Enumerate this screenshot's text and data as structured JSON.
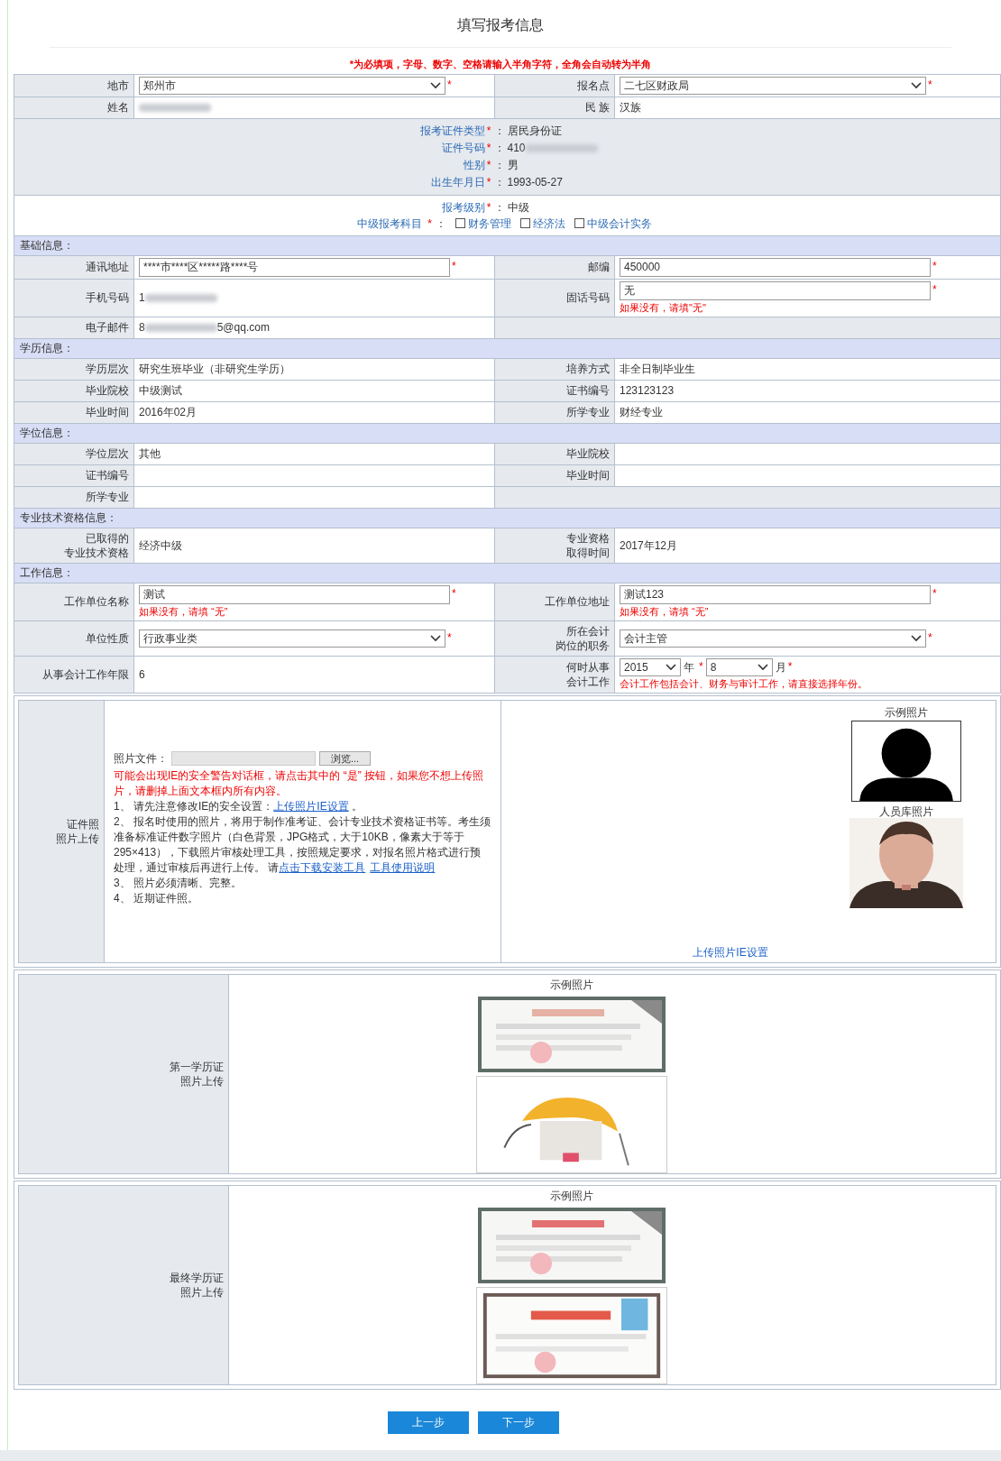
{
  "title": "填写报考信息",
  "notice": "*为必填项，字母、数字、空格请输入半角字符，全角会自动转为半角",
  "required_mark": "*",
  "colon": "：",
  "top_rows": [
    {
      "left": {
        "label": "地市",
        "field": {
          "kind": "select",
          "value": "郑州市",
          "required": true
        }
      },
      "right": {
        "label": "报名点",
        "field": {
          "kind": "select",
          "value": "二七区财政局",
          "required": true
        }
      }
    },
    {
      "left": {
        "label": "姓名",
        "field": {
          "kind": "parts",
          "parts": [
            {
              "kind": "blur"
            }
          ]
        }
      },
      "right": {
        "label": "民 族",
        "field": {
          "kind": "text",
          "value": "汉族"
        }
      }
    }
  ],
  "identity": [
    {
      "label": "报考证件类型",
      "required": true,
      "parts": [
        {
          "kind": "text",
          "text": "居民身份证"
        }
      ]
    },
    {
      "label": "证件号码",
      "required": true,
      "parts": [
        {
          "kind": "text",
          "text": "410"
        },
        {
          "kind": "blur"
        }
      ]
    },
    {
      "label": "性别",
      "required": true,
      "parts": [
        {
          "kind": "text",
          "text": "男"
        }
      ]
    },
    {
      "label": "出生年月日",
      "required": true,
      "parts": [
        {
          "kind": "text",
          "text": "1993-05-27"
        }
      ]
    }
  ],
  "exam_level": {
    "label": "报考级别",
    "required": true,
    "value": "中级"
  },
  "subjects": {
    "label": "中级报考科目",
    "required": true,
    "options": [
      {
        "label": "财务管理",
        "checked": false
      },
      {
        "label": "经济法",
        "checked": false
      },
      {
        "label": "中级会计实务",
        "checked": false
      }
    ]
  },
  "sections": [
    {
      "heading": "基础信息：",
      "rows": [
        {
          "left": {
            "label": "通讯地址",
            "field": {
              "kind": "input",
              "value": "****市****区*****路****号",
              "required": true
            }
          },
          "right": {
            "label": "邮编",
            "field": {
              "kind": "input",
              "value": "450000",
              "required": true
            }
          }
        },
        {
          "left": {
            "label": "手机号码",
            "field": {
              "kind": "parts",
              "parts": [
                {
                  "kind": "text",
                  "text": "1"
                },
                {
                  "kind": "blur"
                }
              ]
            }
          },
          "right": {
            "label": "固话号码",
            "field": {
              "kind": "input",
              "value": "无",
              "required": true,
              "hint": "如果没有，请填\"无\""
            }
          }
        },
        {
          "left": {
            "label": "电子邮件",
            "field": {
              "kind": "parts",
              "parts": [
                {
                  "kind": "text",
                  "text": "8"
                },
                {
                  "kind": "blur"
                },
                {
                  "kind": "text",
                  "text": "5@qq.com"
                }
              ]
            }
          }
        }
      ]
    },
    {
      "heading": "学历信息：",
      "rows": [
        {
          "left": {
            "label": "学历层次",
            "field": {
              "kind": "text",
              "value": "研究生班毕业（非研究生学历）"
            }
          },
          "right": {
            "label": "培养方式",
            "field": {
              "kind": "text",
              "value": "非全日制毕业生"
            }
          }
        },
        {
          "left": {
            "label": "毕业院校",
            "field": {
              "kind": "text",
              "value": "中级测试"
            }
          },
          "right": {
            "label": "证书编号",
            "field": {
              "kind": "text",
              "value": "123123123"
            }
          }
        },
        {
          "left": {
            "label": "毕业时间",
            "field": {
              "kind": "text",
              "value": "2016年02月"
            }
          },
          "right": {
            "label": "所学专业",
            "field": {
              "kind": "text",
              "value": "财经专业"
            }
          }
        }
      ]
    },
    {
      "heading": "学位信息：",
      "rows": [
        {
          "left": {
            "label": "学位层次",
            "field": {
              "kind": "text",
              "value": "其他"
            }
          },
          "right": {
            "label": "毕业院校"
          }
        },
        {
          "left": {
            "label": "证书编号"
          },
          "right": {
            "label": "毕业时间"
          }
        },
        {
          "left": {
            "label": "所学专业"
          }
        }
      ]
    },
    {
      "heading": "专业技术资格信息：",
      "rows": [
        {
          "left": {
            "label": [
              "已取得的",
              "专业技术资格"
            ],
            "field": {
              "kind": "text",
              "value": "经济中级"
            }
          },
          "right": {
            "label": [
              "专业资格",
              "取得时间"
            ],
            "field": {
              "kind": "text",
              "value": "2017年12月"
            }
          }
        }
      ]
    },
    {
      "heading": "工作信息：",
      "rows": [
        {
          "left": {
            "label": "工作单位名称",
            "field": {
              "kind": "input",
              "value": "测试",
              "required": true,
              "hint": "如果没有，请填 “无”"
            }
          },
          "right": {
            "label": "工作单位地址",
            "field": {
              "kind": "input",
              "value": "测试123",
              "required": true,
              "hint": "如果没有，请填 “无”"
            }
          }
        },
        {
          "left": {
            "label": "单位性质",
            "field": {
              "kind": "select",
              "value": "行政事业类",
              "required": true
            }
          },
          "right": {
            "label": [
              "所在会计",
              "岗位的职务"
            ],
            "field": {
              "kind": "select",
              "value": "会计主管",
              "required": true
            }
          }
        },
        {
          "left": {
            "label": "从事会计工作年限",
            "field": {
              "kind": "text",
              "value": "6"
            }
          },
          "right": {
            "label": [
              "何时从事",
              "会计工作"
            ],
            "field": {
              "kind": "year_month",
              "year": "2015",
              "year_unit": "年",
              "month": "8",
              "month_unit": "月",
              "required": true,
              "hint": "会计工作包括会计、财务与审计工作，请直接选择年份。"
            }
          }
        }
      ]
    }
  ],
  "photo_upload": {
    "label": [
      "证件照",
      "照片上传"
    ],
    "file_label": "照片文件：",
    "browse_button": "浏览...",
    "warning": "可能会出现IE的安全警告对话框，请点击其中的 “是” 按钮，如果您不想上传照片，请删掉上面文本框内所有内容。",
    "instructions": [
      [
        {
          "kind": "text",
          "text": "1、 请先注意修改IE的安全设置："
        },
        {
          "kind": "link",
          "text": "上传照片IE设置"
        },
        {
          "kind": "text",
          "text": " 。"
        }
      ],
      [
        {
          "kind": "text",
          "text": "2、 报名时使用的照片，将用于制作准考证、会计专业技术资格证书等。考生须准备标准证件数字照片（白色背景，JPG格式，大于10KB，像素大于等于295×413），下载照片审核处理工具，按照规定要求，对报名照片格式进行预处理，通过审核后再进行上传。 请"
        },
        {
          "kind": "link",
          "text": "点击下载安装工具"
        },
        {
          "kind": "link",
          "text": "工具使用说明"
        }
      ],
      [
        {
          "kind": "text",
          "text": "3、 照片必须清晰、完整。"
        }
      ],
      [
        {
          "kind": "text",
          "text": "4、 近期证件照。"
        }
      ]
    ],
    "sample_caption": "示例照片",
    "library_caption": "人员库照片",
    "settings_link": "上传照片IE设置"
  },
  "certificates": [
    {
      "label": [
        "第一学历证",
        "照片上传"
      ],
      "caption": "示例照片"
    },
    {
      "label": [
        "最终学历证",
        "照片上传"
      ],
      "caption": "示例照片"
    }
  ],
  "buttons": [
    "上一步",
    "下一步"
  ]
}
